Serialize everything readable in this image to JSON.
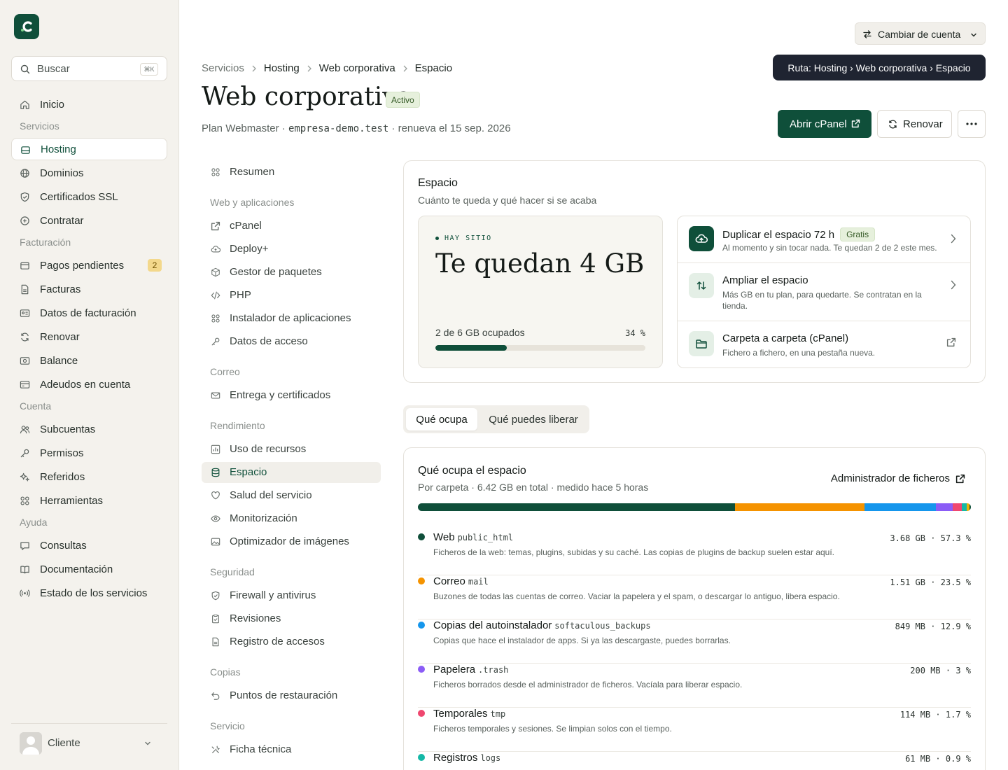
{
  "sidebar": {
    "search_placeholder": "Buscar",
    "search_shortcut": "⌘K",
    "nav": {
      "inicio": "Inicio",
      "sec_servicios": "Servicios",
      "hosting": "Hosting",
      "dominios": "Dominios",
      "ssl": "Certificados SSL",
      "contratar": "Contratar",
      "sec_facturacion": "Facturación",
      "pagos": "Pagos pendientes",
      "pagos_count": "2",
      "facturas": "Facturas",
      "datos_fact": "Datos de facturación",
      "renovar": "Renovar",
      "balance": "Balance",
      "adeudos": "Adeudos en cuenta",
      "sec_cuenta": "Cuenta",
      "subcuentas": "Subcuentas",
      "permisos": "Permisos",
      "referidos": "Referidos",
      "herramientas": "Herramientas",
      "sec_ayuda": "Ayuda",
      "consultas": "Consultas",
      "documentacion": "Documentación",
      "estado": "Estado de los servicios"
    },
    "user": "Cliente"
  },
  "header": {
    "switch_account": "Cambiar de cuenta",
    "tooltip": "Ruta: Hosting › Web corporativa › Espacio",
    "breadcrumb": [
      "Servicios",
      "Hosting",
      "Web corporativa",
      "Espacio"
    ],
    "title": "Web corporativa",
    "status": "Activo",
    "plan": "Plan Webmaster",
    "domain": "empresa-demo.test",
    "renews": "renueva el 15 sep. 2026",
    "btn_cpanel": "Abrir cPanel",
    "btn_renew": "Renovar"
  },
  "secnav": {
    "resumen": "Resumen",
    "sec_web": "Web y aplicaciones",
    "cpanel": "cPanel",
    "deploy": "Deploy+",
    "paquetes": "Gestor de paquetes",
    "php": "PHP",
    "instalador": "Instalador de aplicaciones",
    "acceso": "Datos de acceso",
    "sec_correo": "Correo",
    "entrega": "Entrega y certificados",
    "sec_rend": "Rendimiento",
    "recursos": "Uso de recursos",
    "espacio": "Espacio",
    "salud": "Salud del servicio",
    "monitor": "Monitorización",
    "optim": "Optimizador de imágenes",
    "sec_seg": "Seguridad",
    "firewall": "Firewall y antivirus",
    "revisiones": "Revisiones",
    "registro": "Registro de accesos",
    "sec_copias": "Copias",
    "puntos": "Puntos de restauración",
    "sec_servicio": "Servicio",
    "ficha": "Ficha técnica"
  },
  "espacio": {
    "title": "Espacio",
    "subtitle": "Cuánto te queda y qué hacer si se acaba",
    "quota_label": "HAY SITIO",
    "quota_big": "Te quedan 4 GB",
    "quota_used": "2 de 6 GB ocupados",
    "quota_pct": "34 %",
    "quota_fraction": 0.34,
    "actions": [
      {
        "title": "Duplicar el espacio 72 h",
        "badge": "Gratis",
        "desc": "Al momento y sin tocar nada. Te quedan 2 de 2 este mes."
      },
      {
        "title": "Ampliar el espacio",
        "desc": "Más GB en tu plan, para quedarte. Se contratan en la tienda."
      },
      {
        "title": "Carpeta a carpeta (cPanel)",
        "desc": "Fichero a fichero, en una pestaña nueva."
      }
    ]
  },
  "tabs": [
    "Qué ocupa",
    "Qué puedes liberar"
  ],
  "usage": {
    "title": "Qué ocupa el espacio",
    "subtitle_parts": [
      "Por carpeta",
      "6.42 GB en total",
      "medido hace 5 horas"
    ],
    "file_manager": "Administrador de ficheros",
    "segments": [
      {
        "color": "#0f4f3a",
        "pct": 57.3
      },
      {
        "color": "#f59300",
        "pct": 23.5
      },
      {
        "color": "#1596ec",
        "pct": 12.9
      },
      {
        "color": "#8b5cf6",
        "pct": 3
      },
      {
        "color": "#ef476f",
        "pct": 1.7
      },
      {
        "color": "#14b8a6",
        "pct": 0.9
      },
      {
        "color": "#eab308",
        "pct": 0.4
      },
      {
        "color": "#0f4f3a",
        "pct": 0.3
      }
    ],
    "rows": [
      {
        "name": "Web",
        "path": "public_html",
        "desc": "Ficheros de la web: temas, plugins, subidas y su caché. Las copias de plugins de backup suelen estar aquí.",
        "size": "3.68 GB · 57.3 %",
        "color": "#0f4f3a"
      },
      {
        "name": "Correo",
        "path": "mail",
        "desc": "Buzones de todas las cuentas de correo. Vaciar la papelera y el spam, o descargar lo antiguo, libera espacio.",
        "size": "1.51 GB · 23.5 %",
        "color": "#f59300"
      },
      {
        "name": "Copias del autoinstalador",
        "path": "softaculous_backups",
        "desc": "Copias que hace el instalador de apps. Si ya las descargaste, puedes borrarlas.",
        "size": "849 MB · 12.9 %",
        "color": "#1596ec"
      },
      {
        "name": "Papelera",
        "path": ".trash",
        "desc": "Ficheros borrados desde el administrador de ficheros. Vacíala para liberar espacio.",
        "size": "200 MB · 3 %",
        "color": "#8b5cf6"
      },
      {
        "name": "Temporales",
        "path": "tmp",
        "desc": "Ficheros temporales y sesiones. Se limpian solos con el tiempo.",
        "size": "114 MB · 1.7 %",
        "color": "#ef476f"
      },
      {
        "name": "Registros",
        "path": "logs",
        "desc": "",
        "size": "61 MB · 0.9 %",
        "color": "#14b8a6"
      }
    ]
  }
}
